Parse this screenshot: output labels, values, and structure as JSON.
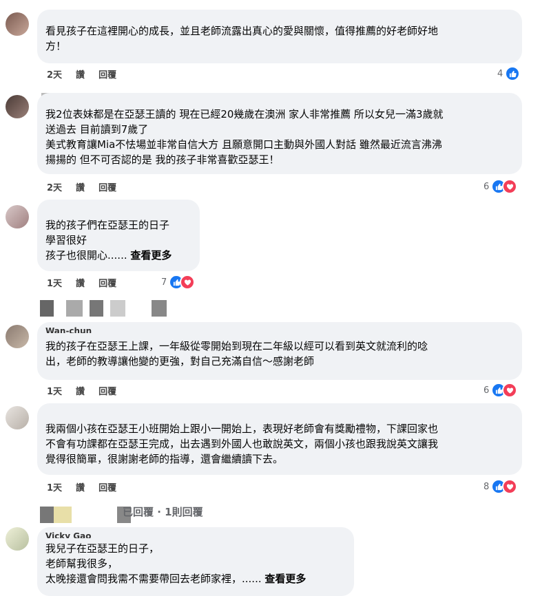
{
  "colors": {
    "bubble_bg": "#f0f2f5",
    "like_blue": "#1877f2",
    "love_red": "#f33e58"
  },
  "comments": [
    {
      "name": "",
      "lines": [
        "看見孩子在這裡開心的成長，並且老師流露出真心的愛與關懷，值得推薦的好老師好地",
        "方！"
      ],
      "time": "2天",
      "like_label": "讚",
      "reply_label": "回覆",
      "reaction_count": "4",
      "reactions": [
        "like-icon"
      ]
    },
    {
      "name": "",
      "lines": [
        "我2位表妹都是在亞瑟王讀的 現在已經20幾歲在澳洲 家人非常推薦 所以女兒一滿3歲就",
        "送過去 目前讀到7歲了",
        "美式教育讓Mia不怯場並非常自信大方 且願意開口主動與外國人對話 雖然最近流言沸沸",
        "揚揚的 但不可否認的是 我的孩子非常喜歡亞瑟王！"
      ],
      "time": "2天",
      "like_label": "讚",
      "reply_label": "回覆",
      "reaction_count": "6",
      "reactions": [
        "like-icon",
        "heart-icon"
      ]
    },
    {
      "name": "",
      "lines": [
        "我的孩子們在亞瑟王的日子",
        "學習很好",
        "孩子也很開心......"
      ],
      "see_more": "查看更多",
      "time": "1天",
      "like_label": "讚",
      "reply_label": "回覆",
      "reaction_count": "7",
      "reactions": [
        "like-icon",
        "heart-icon"
      ]
    },
    {
      "name": "Wan-chun",
      "lines": [
        "我的孩子在亞瑟王上課，一年級從零開始到現在二年級以經可以看到英文就流利的唸",
        "出，老師的教導讓他變的更強，對自己充滿自信～感謝老師"
      ],
      "time": "1天",
      "like_label": "讚",
      "reply_label": "回覆",
      "reaction_count": "6",
      "reactions": [
        "like-icon",
        "heart-icon"
      ]
    },
    {
      "name": "",
      "lines": [
        "我兩個小孩在亞瑟王小班開始上跟小一開始上，表現好老師會有獎勵禮物，下課回家也",
        "不會有功課都在亞瑟王完成，出去遇到外國人也敢說英文，兩個小孩也跟我說英文讓我",
        "覺得很簡單，很謝謝老師的指導，還會繼續讀下去。"
      ],
      "time": "1天",
      "like_label": "讚",
      "reply_label": "回覆",
      "reaction_count": "8",
      "reactions": [
        "like-icon",
        "heart-icon"
      ]
    },
    {
      "name": "Vicky Gao",
      "lines": [
        "我兒子在亞瑟王的日子，",
        "老師幫我很多，",
        "太晚接還會問我需不需要帶回去老師家裡，......"
      ],
      "see_more": "查看更多"
    }
  ],
  "reply_summary": "已回覆 · 1則回覆"
}
